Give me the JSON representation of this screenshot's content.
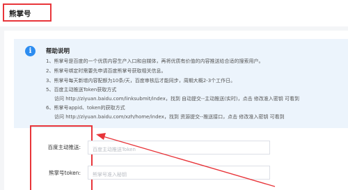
{
  "header": {
    "tab_title": "熊掌号"
  },
  "help": {
    "icon": "info-icon",
    "title": "帮助说明",
    "lines": [
      "1、熊掌号是百度的一个优质内容生产入口和自媒体，再将优质有价值的内容推送给合适的搜索用户。",
      "2、熊掌号绑定时需要先申请百度熊掌号获取相关信息。",
      "3、熊掌号每天新增内容配额为10条/天，百度审核后才能同步，周期大概2-3个工作日。",
      "5、百度主动推送Token获取方式",
      "访问 http://ziyuan.baidu.com/linksubmit/index，找到 自动提交--主动推送(实时)，点击 修改准入密钥 可看到",
      "6、熊掌号appid、token的获取方式",
      "访问 http://ziyuan.baidu.com/xzh/home/index，找到 资源提交--推送接口，点击 修改准入密钥 可看到"
    ]
  },
  "form": {
    "push_token": {
      "label": "百度主动推送:",
      "placeholder": "百度主动推送Token"
    },
    "xzh_token": {
      "label": "熊掌号token:",
      "placeholder": "熊掌号准入秘钥"
    }
  },
  "colors": {
    "highlight": "#e8353a",
    "info": "#2c8cf0",
    "help_bg": "#ecf4fc"
  }
}
